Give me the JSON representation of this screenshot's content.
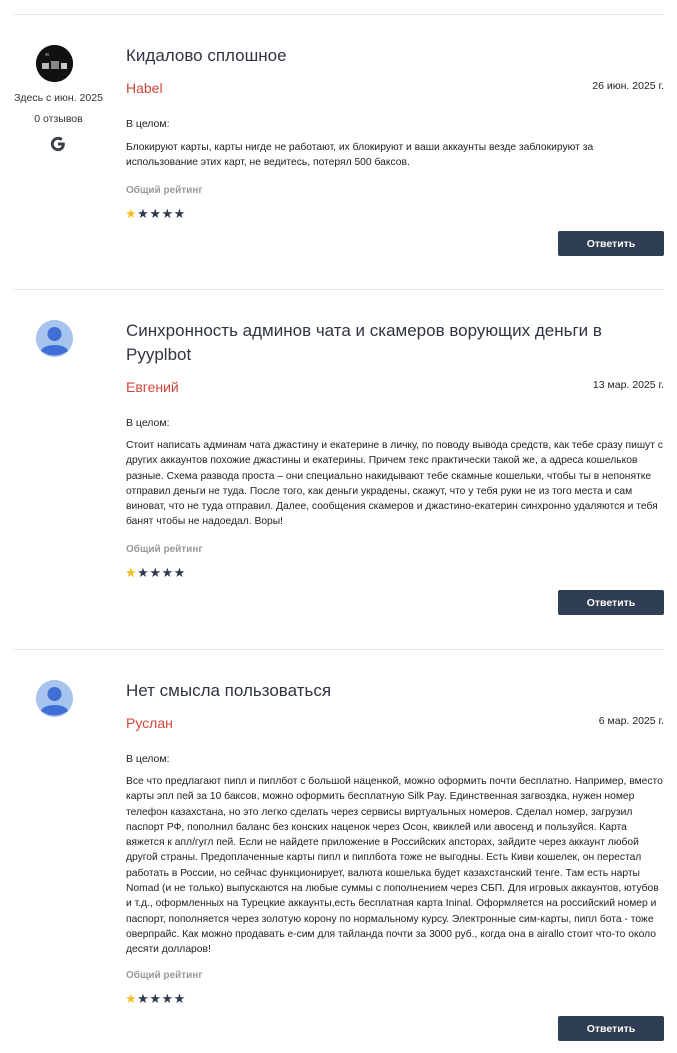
{
  "colors": {
    "author": "#d0453b",
    "star_active": "#f4bf1f",
    "star_inactive": "#2e3a4f",
    "reply_button_bg": "#2f3e53",
    "title": "#2f3440"
  },
  "reviews": [
    {
      "avatar": "photo-avatar",
      "member_since": "Здесь с июн. 2025",
      "review_count": "0 отзывов",
      "source_icon": "google-icon",
      "title": "Кидалово сплошное",
      "author": "Habel",
      "date": "26 июн. 2025 г.",
      "overall_label": "В целом:",
      "body": "Блокируют карты, карты нигде не работают, их блокируют и ваши аккаунты везде заблокируют за использование этих карт, не ведитесь, потерял 500 баксов.",
      "rating_label": "Общий рейтинг",
      "rating": 1,
      "rating_max": 5,
      "reply_label": "Ответить"
    },
    {
      "avatar": "default-user-icon",
      "title": "Синхронность админов чата и скамеров ворующих деньги в Pyyplbot",
      "author": "Евгений",
      "date": "13 мар. 2025 г.",
      "overall_label": "В целом:",
      "body": "Стоит написать админам чата джастину и екатерине в личку, по поводу вывода средств, как тебе сразу пишут с других аккаунтов похожие джастины и екатерины. Причем текс практически такой же, а адреса кошельков разные. Схема развода проста – они специально накидывают тебе скамные кошельки, чтобы ты в непонятке отправил деньги не туда. После того, как деньги украдены, скажут, что у тебя руки не из того места и сам виноват, что не туда отправил. Далее, сообщения скамеров и джастино-екатерин синхронно удаляются и тебя банят чтобы не надоедал. Воры!",
      "rating_label": "Общий рейтинг",
      "rating": 1,
      "rating_max": 5,
      "reply_label": "Ответить"
    },
    {
      "avatar": "default-user-icon",
      "title": "Нет смысла пользоваться",
      "author": "Руслан",
      "date": "6 мар. 2025 г.",
      "overall_label": "В целом:",
      "body": "Все что предлагают пипл и пиплбот с большой наценкой, можно оформить почти бесплатно. Например, вместо карты эпл пей за 10 баксов, можно оформить бесплатную Silk Pay. Единственная загвоздка, нужен номер телефон казахстана, но это легко сделать через сервисы виртуальных номеров. Сделал номер, загрузил паспорт РФ, пополнил баланс без конских наценок через Осон, квиклей или авосенд и пользуйся. Карта вяжется к апл/гугл пей. Если не найдете приложение в Российских апсторах, зайдите через аккаунт любой другой страны. Предоплаченные карты пипл и пиплбота тоже не выгодны. Есть Киви кошелек, он перестал работать в России, но сейчас функционирует, валюта кошелька будет казахстанский тенге. Там есть нарты Nomad (и не только) выпускаются на любые суммы с пополнением через СБП. Для игровых аккаунтов, ютубов и т.д., оформленных на Турецкие аккаунты,есть бесплатная карта Ininal. Оформляется на российский номер и паспорт, пополняется через золотую корону по нормальному курсу. Электронные сим-карты, пипл бота - тоже оверпрайс. Как можно продавать е-сим для тайланда почти за 3000 руб., когда она в airallo стоит что-то около десяти долларов!",
      "rating_label": "Общий рейтинг",
      "rating": 1,
      "rating_max": 5,
      "reply_label": "Ответить"
    }
  ]
}
